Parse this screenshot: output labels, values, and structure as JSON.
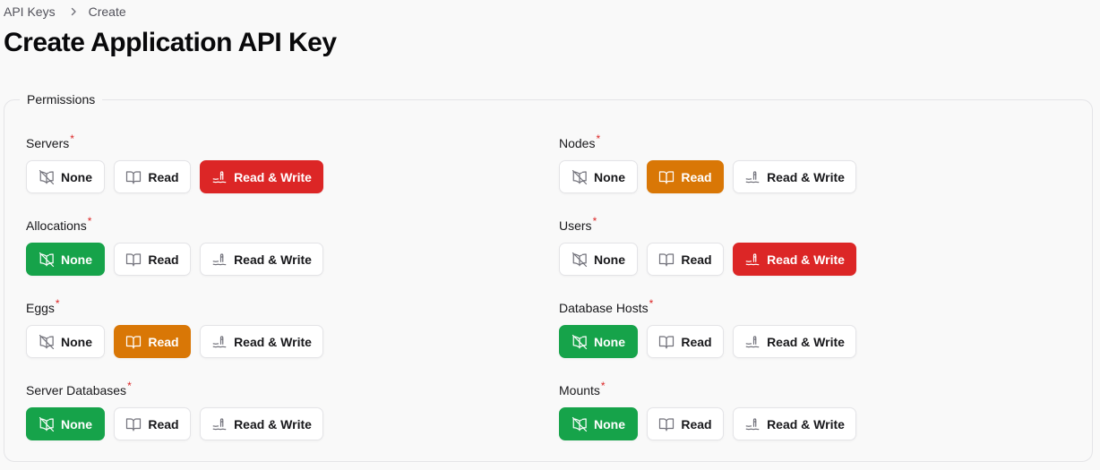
{
  "breadcrumb": {
    "items": [
      "API Keys",
      "Create"
    ]
  },
  "page": {
    "title": "Create Application API Key"
  },
  "permissions": {
    "legend": "Permissions",
    "required_mark": "*",
    "option_labels": {
      "none": "None",
      "read": "Read",
      "read_write": "Read & Write"
    },
    "selected_colors": {
      "none": "#16a34a",
      "read": "#d97706",
      "read_write": "#dc2626"
    },
    "items": [
      {
        "label": "Servers",
        "selected": "read_write"
      },
      {
        "label": "Nodes",
        "selected": "read"
      },
      {
        "label": "Allocations",
        "selected": "none"
      },
      {
        "label": "Users",
        "selected": "read_write"
      },
      {
        "label": "Eggs",
        "selected": "read"
      },
      {
        "label": "Database Hosts",
        "selected": "none"
      },
      {
        "label": "Server Databases",
        "selected": "none"
      },
      {
        "label": "Mounts",
        "selected": "none"
      }
    ]
  },
  "icons": {
    "none": "book-off-icon",
    "read": "book-open-icon",
    "read_write": "pencil-write-icon"
  }
}
